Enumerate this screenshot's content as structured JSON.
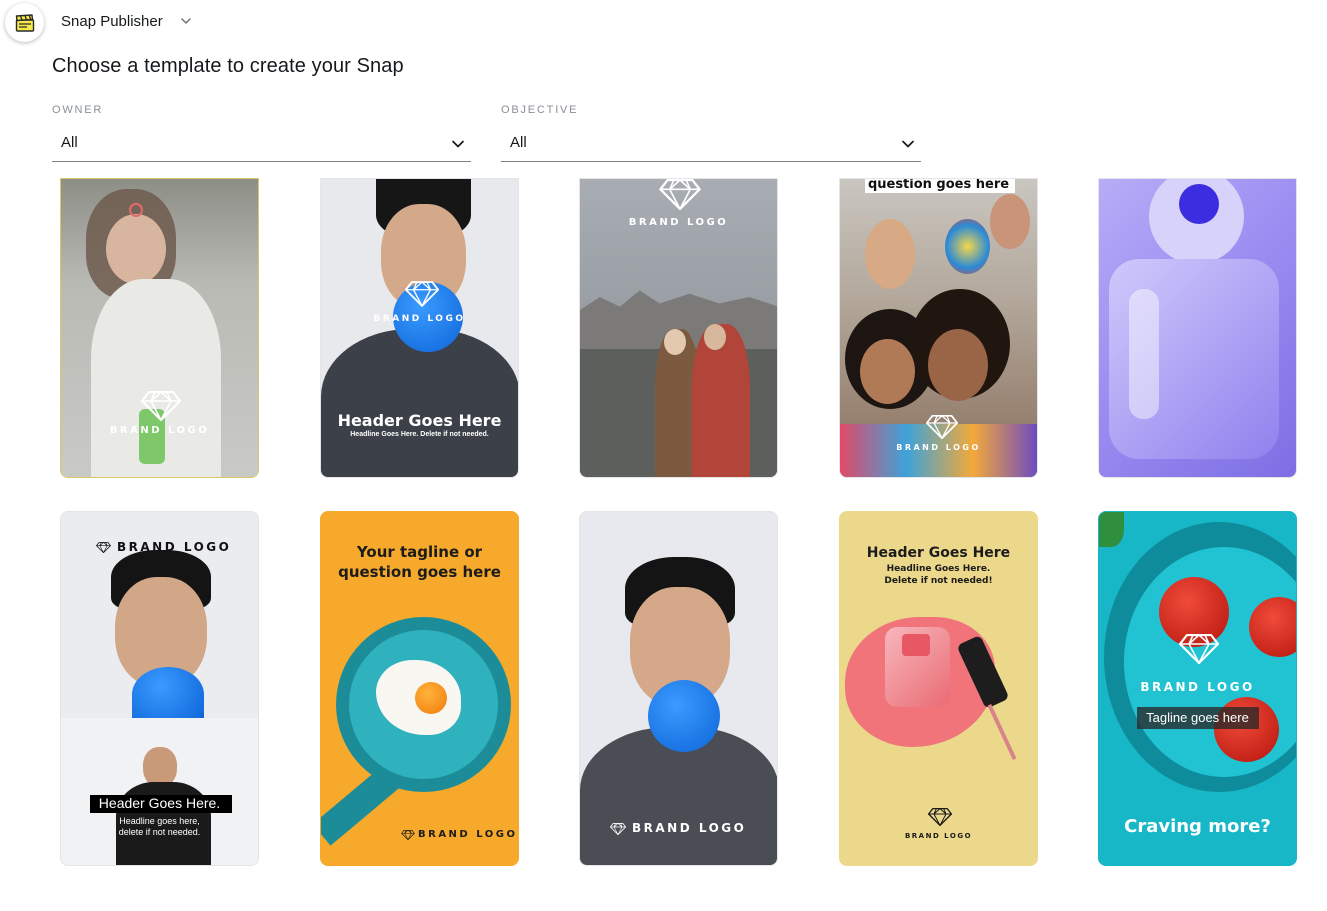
{
  "app": {
    "name": "Snap Publisher",
    "icon": "clapperboard-icon"
  },
  "page": {
    "title": "Choose a template to create your Snap"
  },
  "filters": {
    "owner": {
      "label": "OWNER",
      "value": "All"
    },
    "objective": {
      "label": "OBJECTIVE",
      "value": "All"
    }
  },
  "templates": [
    {
      "brand": "BRAND LOGO"
    },
    {
      "brand": "BRAND LOGO",
      "header": "Header Goes Here",
      "sub": "Headline Goes Here. Delete if not needed."
    },
    {
      "brand": "BRAND LOGO"
    },
    {
      "caption": "question goes here",
      "brand": "BRAND LOGO"
    },
    {},
    {
      "brand": "BRAND LOGO",
      "header": "Header Goes Here.",
      "sub1": "Headline goes here,",
      "sub2": "delete if not needed."
    },
    {
      "tag1": "Your tagline or",
      "tag2": "question goes here",
      "brand": "BRAND LOGO"
    },
    {
      "brand": "BRAND LOGO"
    },
    {
      "header": "Header Goes Here",
      "sub1": "Headline Goes Here.",
      "sub2": "Delete if not needed!",
      "brand": "BRAND LOGO"
    },
    {
      "brand": "BRAND LOGO",
      "tagline": "Tagline goes here",
      "cta": "Craving more?"
    }
  ],
  "colors": {
    "accent_blue": "#1e7ef0",
    "orange": "#f6a92a",
    "teal": "#18b7c7",
    "lilac": "#9b8ef2",
    "yellow": "#ecd88b"
  }
}
